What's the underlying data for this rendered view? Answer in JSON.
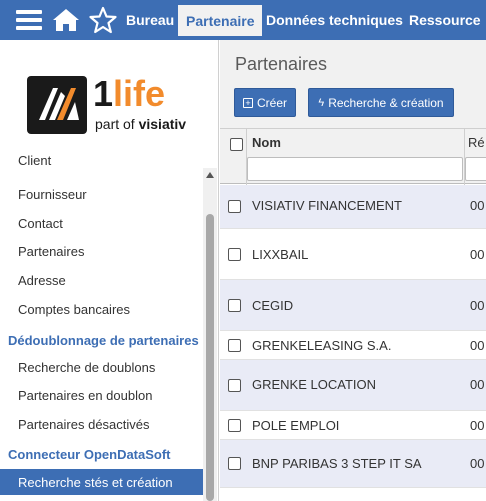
{
  "icons": {
    "menu": "hamburger-icon",
    "home": "home-icon",
    "favorites": "star-icon"
  },
  "colors": {
    "brand": "#3d6eb4",
    "row_alt": "#e9ebf6",
    "logo_accent": "#f28b2c"
  },
  "topbar": {
    "tabs": [
      {
        "label": "Bureau"
      },
      {
        "label": "Partenaire"
      },
      {
        "label": "Données techniques"
      },
      {
        "label": "Ressource"
      }
    ]
  },
  "logo": {
    "brand_1": "1",
    "brand_life": "life",
    "tagline_part": "part of ",
    "tagline_brand": "visiativ"
  },
  "sidebar": {
    "items": [
      {
        "label": "Client"
      },
      {
        "label": "Fournisseur"
      },
      {
        "label": "Contact"
      },
      {
        "label": "Partenaires"
      },
      {
        "label": "Adresse"
      },
      {
        "label": "Comptes bancaires"
      }
    ],
    "section_dedup": "Dédoublonnage de partenaires",
    "dedup_items": [
      {
        "label": "Recherche de doublons"
      },
      {
        "label": "Partenaires en doublon"
      },
      {
        "label": "Partenaires désactivés"
      }
    ],
    "section_connector": "Connecteur OpenDataSoft",
    "connector_items": [
      {
        "label": "Recherche stés et création"
      }
    ]
  },
  "main": {
    "title": "Partenaires",
    "create_label": "Créer",
    "search_create_label": "Recherche & création",
    "columns": {
      "name": "Nom",
      "ref": "Ré"
    },
    "rows": [
      {
        "name": "VISIATIV FINANCEMENT",
        "ref": "00"
      },
      {
        "name": "LIXXBAIL",
        "ref": "00"
      },
      {
        "name": "CEGID",
        "ref": "00"
      },
      {
        "name": "GRENKELEASING S.A.",
        "ref": "00"
      },
      {
        "name": "GRENKE LOCATION",
        "ref": "00"
      },
      {
        "name": "POLE EMPLOI",
        "ref": "00"
      },
      {
        "name": "BNP PARIBAS 3 STEP IT SA",
        "ref": "00"
      }
    ]
  }
}
